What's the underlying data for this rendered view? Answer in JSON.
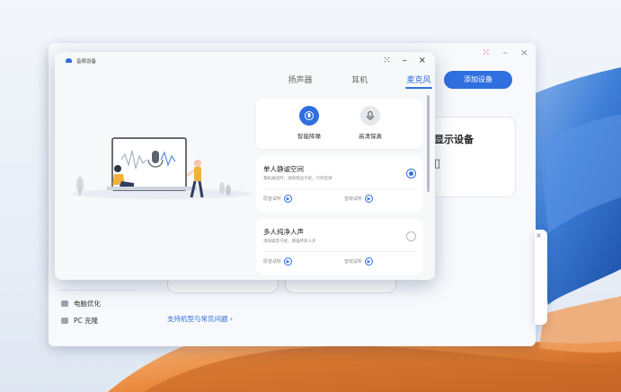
{
  "colors": {
    "accent": "#2f6fe0",
    "desktop_orange": "#e8843a",
    "desktop_blue": "#2b6fcf"
  },
  "main_window": {
    "controls": [
      "⁙",
      "–",
      "×"
    ],
    "add_device_label": "添加设备",
    "card_title": "显示设备",
    "card_glyph": "▯",
    "sidebar": [
      {
        "label": "电脑优化",
        "icon": "optimize-icon"
      },
      {
        "label": "PC 克隆",
        "icon": "clone-icon"
      }
    ],
    "support_link": "支持机型与常见问题 ›"
  },
  "side_window": {
    "close": "×"
  },
  "dialog": {
    "title": "音频设备",
    "controls": [
      "⁙",
      "–",
      "×"
    ],
    "tabs": [
      {
        "label": "扬声器",
        "active": false
      },
      {
        "label": "耳机",
        "active": false
      },
      {
        "label": "麦克风",
        "active": true
      }
    ],
    "modes": [
      {
        "label": "智能降噪",
        "icon": "noise-reduction-icon",
        "selected": true
      },
      {
        "label": "高清保真",
        "icon": "hifi-mic-icon",
        "selected": false
      }
    ],
    "options": [
      {
        "title": "单人静谧空间",
        "desc": "耳机通话时，消除周边干扰，只听您讲",
        "selected": true,
        "listen_before": "原音试听",
        "listen_after": "音效试听"
      },
      {
        "title": "多人纯净人声",
        "desc": "消除噪音干扰，增强所有人声",
        "selected": false,
        "listen_before": "原音试听",
        "listen_after": "音效试听"
      }
    ]
  }
}
